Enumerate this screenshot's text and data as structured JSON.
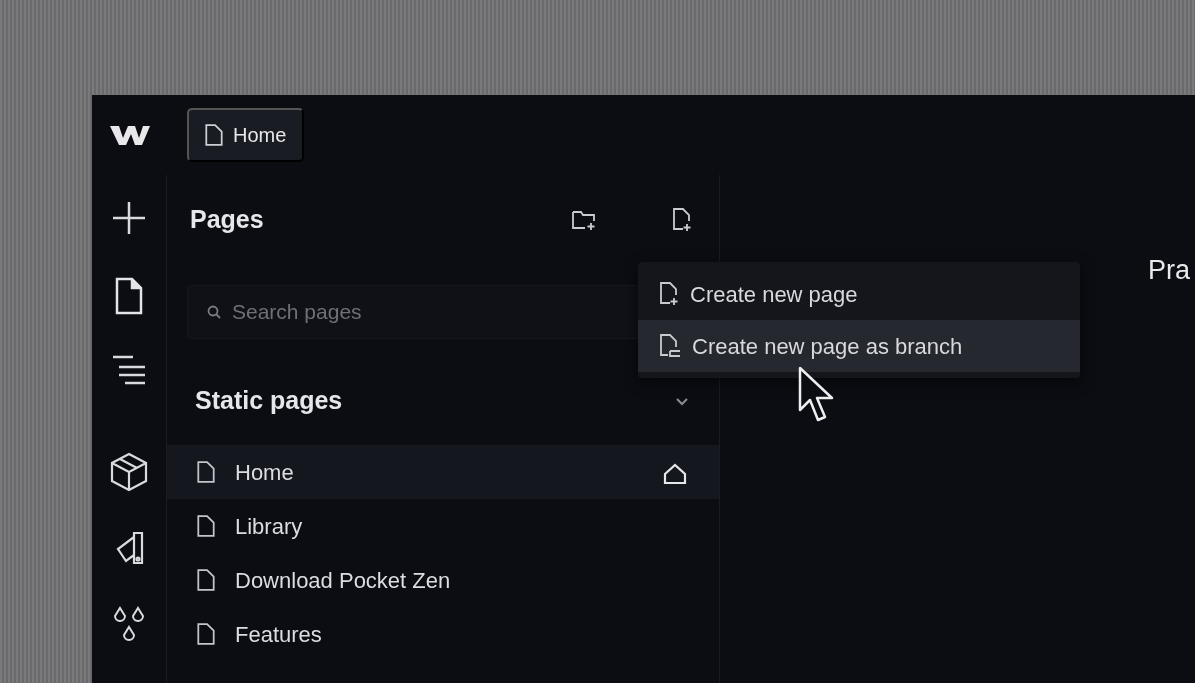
{
  "top_bar": {
    "page_tab": "Home"
  },
  "pages_panel": {
    "title": "Pages",
    "search": {
      "placeholder": "Search pages"
    },
    "section": {
      "title": "Static pages",
      "expanded": true
    },
    "pages": [
      {
        "label": "Home",
        "selected": true,
        "home": true
      },
      {
        "label": "Library",
        "selected": false,
        "home": false
      },
      {
        "label": "Download Pocket Zen",
        "selected": false,
        "home": false
      },
      {
        "label": "Features",
        "selected": false,
        "home": false
      }
    ]
  },
  "create_menu": {
    "items": [
      {
        "label": "Create new page",
        "kind": "page",
        "selected": false
      },
      {
        "label": "Create new page as branch",
        "kind": "branch",
        "selected": true
      }
    ]
  },
  "canvas": {
    "heading": "Pra"
  }
}
